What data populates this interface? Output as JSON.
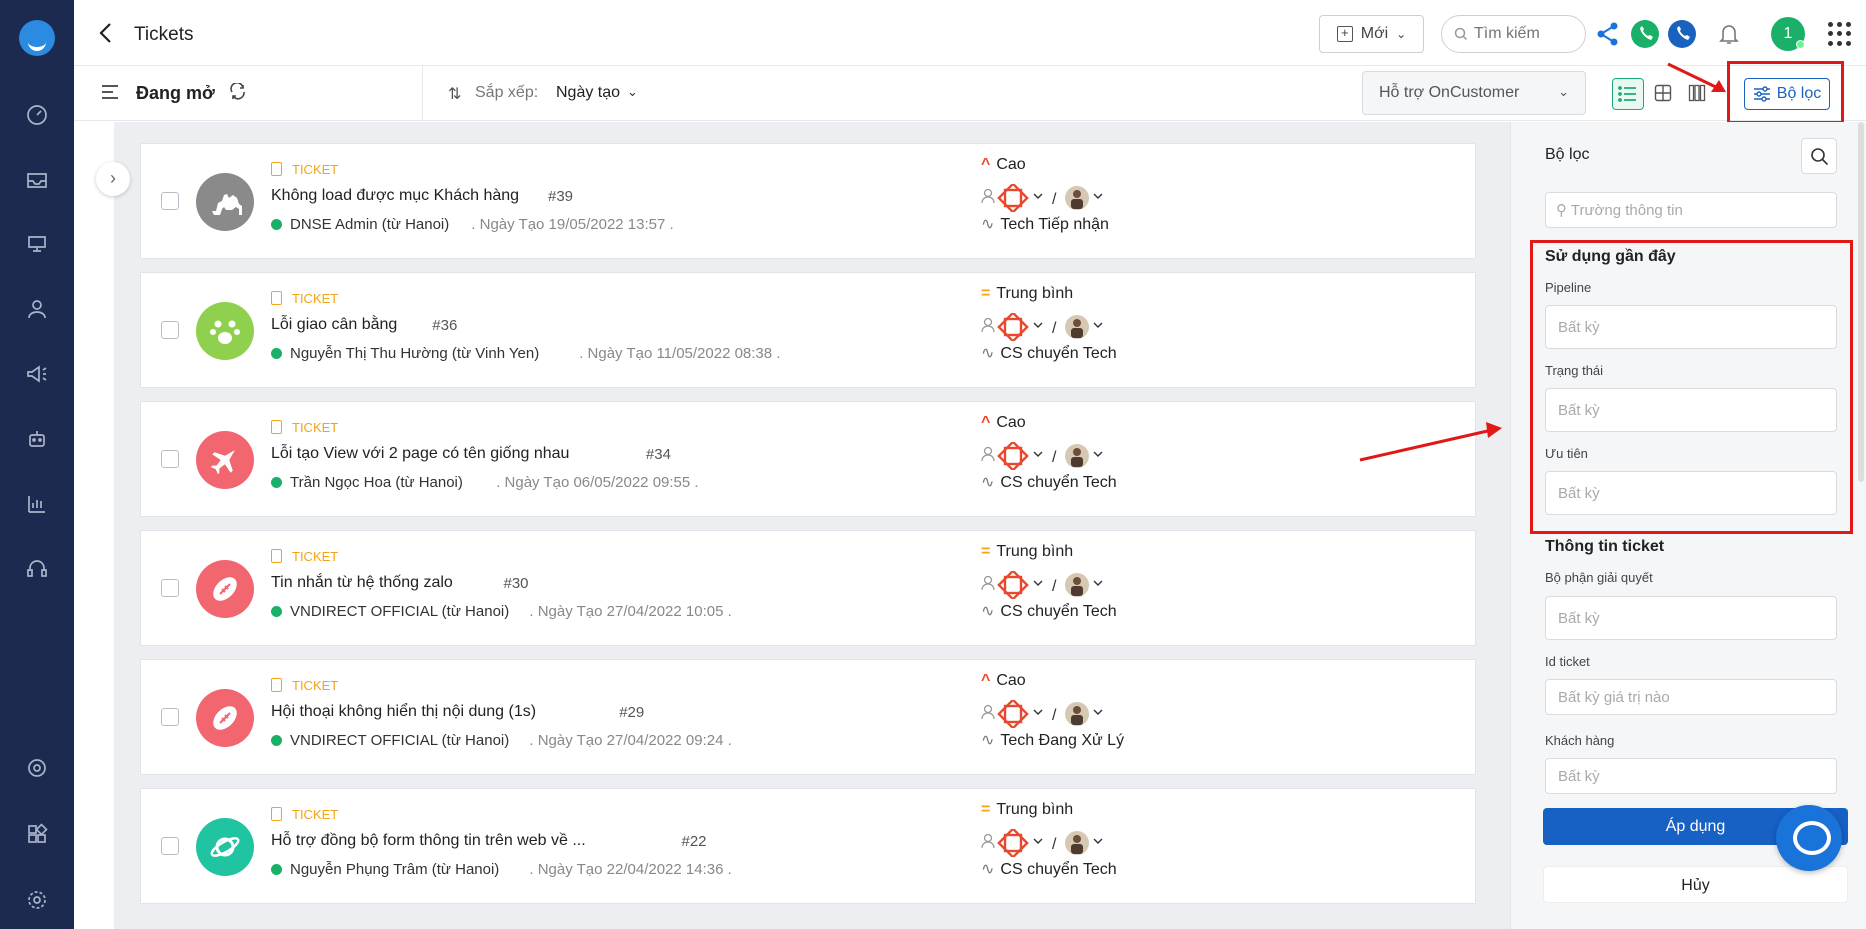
{
  "header": {
    "title": "Tickets",
    "new_label": "Mới",
    "search_placeholder": "Tìm kiếm",
    "user_initial": "1"
  },
  "toolbar": {
    "view_name": "Đang mở",
    "sort_label": "Sắp xếp:",
    "sort_value": "Ngày tạo",
    "team": "Hỗ trợ OnCustomer",
    "filter_label": "Bộ lọc"
  },
  "tickets": [
    {
      "type": "TICKET",
      "title": "Không load được mục Khách hàng",
      "number": "#39",
      "customer": "DNSE Admin (từ Hanoi)",
      "created": ". Ngày Tạo 19/05/2022 13:57 .",
      "priority": "Cao",
      "priority_level": "high",
      "stage": "Tech Tiếp nhận",
      "avatar_color": "#8a8a8a",
      "avatar_icon": "camel-icon"
    },
    {
      "type": "TICKET",
      "title": "Lỗi giao cân bằng",
      "number": "#36",
      "customer": "Nguyễn Thị Thu Hường (từ Vinh Yen)",
      "created": ". Ngày Tạo 11/05/2022 08:38 .",
      "priority": "Trung bình",
      "priority_level": "mid",
      "stage": "CS chuyển Tech",
      "avatar_color": "#8fd14f",
      "avatar_icon": "paw-icon"
    },
    {
      "type": "TICKET",
      "title": "Lỗi tạo View với 2 page có tên giống nhau",
      "number": "#34",
      "customer": "Trần Ngọc Hoa (từ Hanoi)",
      "created": ". Ngày Tạo 06/05/2022 09:55 .",
      "priority": "Cao",
      "priority_level": "high",
      "stage": "CS chuyển Tech",
      "avatar_color": "#f26670",
      "avatar_icon": "plane-icon"
    },
    {
      "type": "TICKET",
      "title": "Tin nhắn từ hệ thống zalo",
      "number": "#30",
      "customer": "VNDIRECT OFFICIAL (từ Hanoi)",
      "created": ". Ngày Tạo 27/04/2022 10:05 .",
      "priority": "Trung bình",
      "priority_level": "mid",
      "stage": "CS chuyển Tech",
      "avatar_color": "#f26670",
      "avatar_icon": "football-icon"
    },
    {
      "type": "TICKET",
      "title": "Hội thoại không hiển thị nội dung (1s)",
      "number": "#29",
      "customer": "VNDIRECT OFFICIAL (từ Hanoi)",
      "created": ". Ngày Tạo 27/04/2022 09:24 .",
      "priority": "Cao",
      "priority_level": "high",
      "stage": "Tech Đang Xử Lý",
      "avatar_color": "#f26670",
      "avatar_icon": "football-icon"
    },
    {
      "type": "TICKET",
      "title": "Hỗ trợ đồng bộ form thông tin trên web về ...",
      "number": "#22",
      "customer": "Nguyễn Phụng Trâm (từ Hanoi)",
      "created": ". Ngày Tạo 22/04/2022 14:36 .",
      "priority": "Trung bình",
      "priority_level": "mid",
      "stage": "CS chuyển Tech",
      "avatar_color": "#20c4a0",
      "avatar_icon": "planet-icon"
    }
  ],
  "filter_panel": {
    "title": "Bộ lọc",
    "field_search_placeholder": "Trường thông tin",
    "recent_section": "Sử dụng gần đây",
    "pipeline_label": "Pipeline",
    "pipeline_placeholder": "Bất kỳ",
    "status_label": "Trạng thái",
    "status_placeholder": "Bất kỳ",
    "priority_label": "Ưu tiên",
    "priority_placeholder": "Bất kỳ",
    "ticket_info_section": "Thông tin ticket",
    "department_label": "Bộ phận giải quyết",
    "department_placeholder": "Bất kỳ",
    "id_label": "Id ticket",
    "id_placeholder": "Bất kỳ giá trị nào",
    "customer_label": "Khách hàng",
    "customer_placeholder": "Bất kỳ",
    "apply_label": "Áp dụng",
    "cancel_label": "Hủy"
  },
  "colors": {
    "nav_bg": "#1b2a4e",
    "accent_blue": "#1760c4",
    "accent_green": "#1ab069",
    "ticket_type": "#f2a417",
    "priority_high": "#e8492e",
    "annotation_red": "#e01818"
  }
}
